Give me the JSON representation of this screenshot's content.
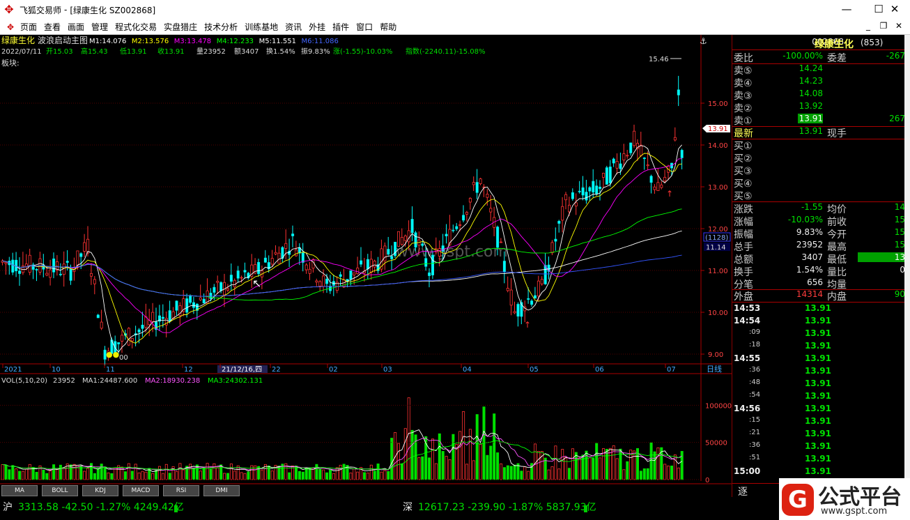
{
  "window": {
    "app": "飞狐交易师",
    "doc": "[绿康生化 SZ002868]",
    "minimize": "—",
    "maximize": "☐",
    "close": "✕"
  },
  "menu": [
    "页面",
    "查看",
    "画面",
    "管理",
    "程式化交易",
    "实盘猎庄",
    "技术分析",
    "训练基地",
    "资讯",
    "外挂",
    "插件",
    "窗口",
    "帮助"
  ],
  "menu_right": {
    "min": "_",
    "restore": "❐",
    "close": "✕"
  },
  "main_header": {
    "name": "绿康生化",
    "indicator": "波浪启动主图",
    "ma": [
      {
        "t": "M1:14.076",
        "c": "#ffffff"
      },
      {
        "t": "M2:13.576",
        "c": "#ffff00"
      },
      {
        "t": "M3:13.478",
        "c": "#ff00ff"
      },
      {
        "t": "M4:12.233",
        "c": "#00ff00"
      },
      {
        "t": "M5:11.551",
        "c": "#ffffff"
      },
      {
        "t": "M6:11.086",
        "c": "#4466ff"
      }
    ],
    "line2": {
      "date": "2022/07/11",
      "open": "开15.03",
      "high": "高15.43",
      "low": "低13.91",
      "close": "收13.91",
      "vol": "量23952",
      "amt": "额3407",
      "turn": "换1.54%",
      "amp": "振9.83%",
      "chg": "涨(-1.55)-10.03%",
      "idx": "指数(-2240.11)-15.08%"
    },
    "block": "板块:"
  },
  "price_axis": [
    "15.00",
    "14.00",
    "13.00",
    "12.00",
    "11.00",
    "10.00",
    "9.00"
  ],
  "price_markers": {
    "high": "15.46",
    "cur": "13.91",
    "bubble": "(1128)",
    "level": "11.14",
    "low_label": "00"
  },
  "date_axis": {
    "labels": [
      "2021",
      "10",
      "11",
      "12",
      "21/12/16,四",
      "22",
      "02",
      "03",
      "04",
      "05",
      "06",
      "07"
    ],
    "right": "日线"
  },
  "vol_header": {
    "name": "VOL(5,10,20)",
    "v": "23952",
    "ma1": "MA1:24487.600",
    "ma2": "MA2:18930.238",
    "ma3": "MA3:24302.131"
  },
  "vol_axis": [
    "100000",
    "50000",
    "0"
  ],
  "watermark": "www.gspt.com",
  "tabs": [
    "MA",
    "BOLL",
    "KDJ",
    "MACD",
    "RSI",
    "DMI"
  ],
  "quote": {
    "code": "002868",
    "name": "绿康生化",
    "count": "(853)",
    "weibi": {
      "label": "委比",
      "val": "-100.00%",
      "label2": "委差",
      "val2": "-267"
    },
    "sells": [
      {
        "label": "卖⑤",
        "price": "14.24",
        "vol": ""
      },
      {
        "label": "卖④",
        "price": "14.23",
        "vol": ""
      },
      {
        "label": "卖③",
        "price": "14.08",
        "vol": ""
      },
      {
        "label": "卖②",
        "price": "13.92",
        "vol": ""
      },
      {
        "label": "卖①",
        "price": "13.91",
        "vol": "267"
      }
    ],
    "latest": {
      "label": "最新",
      "price": "13.91",
      "label2": "现手"
    },
    "buys": [
      "买①",
      "买②",
      "买③",
      "买④",
      "买⑤"
    ],
    "stats": [
      {
        "l1": "涨跌",
        "v1": "-1.55",
        "l2": "均价",
        "v2": "14"
      },
      {
        "l1": "涨幅",
        "v1": "-10.03%",
        "l2": "前收",
        "v2": "15"
      },
      {
        "l1": "振幅",
        "v1": "9.83%",
        "l2": "今开",
        "v2": "15"
      },
      {
        "l1": "总手",
        "v1": "23952",
        "l2": "最高",
        "v2": "15"
      },
      {
        "l1": "总额",
        "v1": "3407",
        "l2": "最低",
        "v2": "13"
      },
      {
        "l1": "换手",
        "v1": "1.54%",
        "l2": "量比",
        "v2": "0"
      },
      {
        "l1": "分笔",
        "v1": "656",
        "l2": "均量",
        "v2": ""
      }
    ],
    "outer": {
      "l1": "外盘",
      "v1": "14314",
      "l2": "内盘",
      "v2": "90"
    },
    "ticks": [
      {
        "t": "14:53",
        "p": "13.91"
      },
      {
        "t": "14:54",
        "p": "13.91"
      },
      {
        "t": ":09",
        "p": "13.91"
      },
      {
        "t": ":18",
        "p": "13.91"
      },
      {
        "t": "14:55",
        "p": "13.91"
      },
      {
        "t": ":36",
        "p": "13.91"
      },
      {
        "t": ":48",
        "p": "13.91"
      },
      {
        "t": ":54",
        "p": "13.91"
      },
      {
        "t": "14:56",
        "p": "13.91"
      },
      {
        "t": ":15",
        "p": "13.91"
      },
      {
        "t": ":21",
        "p": "13.91"
      },
      {
        "t": ":36",
        "p": "13.91"
      },
      {
        "t": ":51",
        "p": "13.91"
      },
      {
        "t": "15:00",
        "p": "13.91"
      }
    ],
    "footer": "逐"
  },
  "status": {
    "sh_label": "沪",
    "sh": "3313.58 -42.50 -1.27% 4249.42亿",
    "sz_label": "深",
    "sz": "12617.23 -239.90 -1.87% 5837.93亿"
  },
  "brand": {
    "name": "公式平台",
    "url": "www.gspt.com",
    "logo": "G"
  }
}
